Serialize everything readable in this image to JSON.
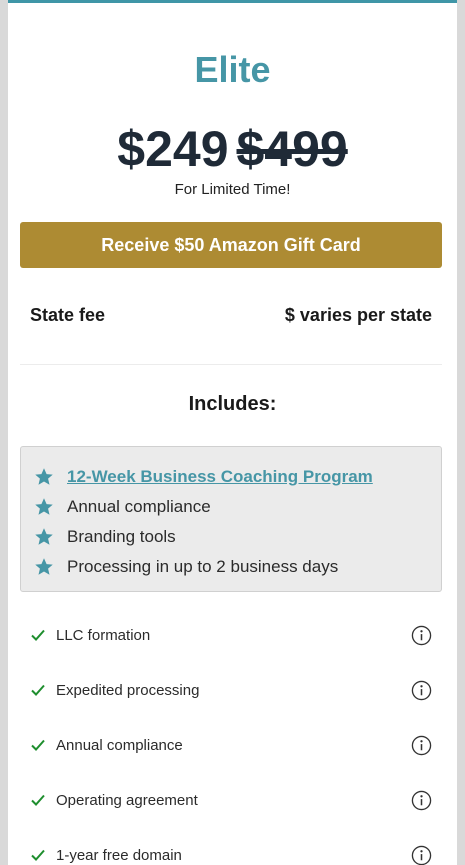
{
  "plan": {
    "name": "Elite",
    "price": "$249",
    "original_price": "$499",
    "promo_note": "For Limited Time!"
  },
  "cta": {
    "label": "Receive $50 Amazon Gift Card"
  },
  "fee": {
    "label": "State fee",
    "value": "$ varies per state"
  },
  "includes": {
    "heading": "Includes:",
    "highlights": [
      {
        "label": "12-Week Business Coaching Program",
        "icon": "star-icon",
        "is_link": true
      },
      {
        "label": "Annual compliance",
        "icon": "star-icon",
        "is_link": false
      },
      {
        "label": "Branding tools",
        "icon": "star-icon",
        "is_link": false
      },
      {
        "label": "Processing in up to 2 business days",
        "icon": "star-icon",
        "is_link": false
      }
    ]
  },
  "features": [
    {
      "label": "LLC formation",
      "icon": "check-icon",
      "info_icon": "info-icon"
    },
    {
      "label": "Expedited processing",
      "icon": "check-icon",
      "info_icon": "info-icon"
    },
    {
      "label": "Annual compliance",
      "icon": "check-icon",
      "info_icon": "info-icon"
    },
    {
      "label": "Operating agreement",
      "icon": "check-icon",
      "info_icon": "info-icon"
    },
    {
      "label": "1-year free domain",
      "icon": "check-icon",
      "info_icon": "info-icon"
    }
  ],
  "colors": {
    "accent": "#4696a6",
    "cta_background": "#ad8b33",
    "check": "#1e8e2e",
    "page_background": "#d9d9d9"
  }
}
